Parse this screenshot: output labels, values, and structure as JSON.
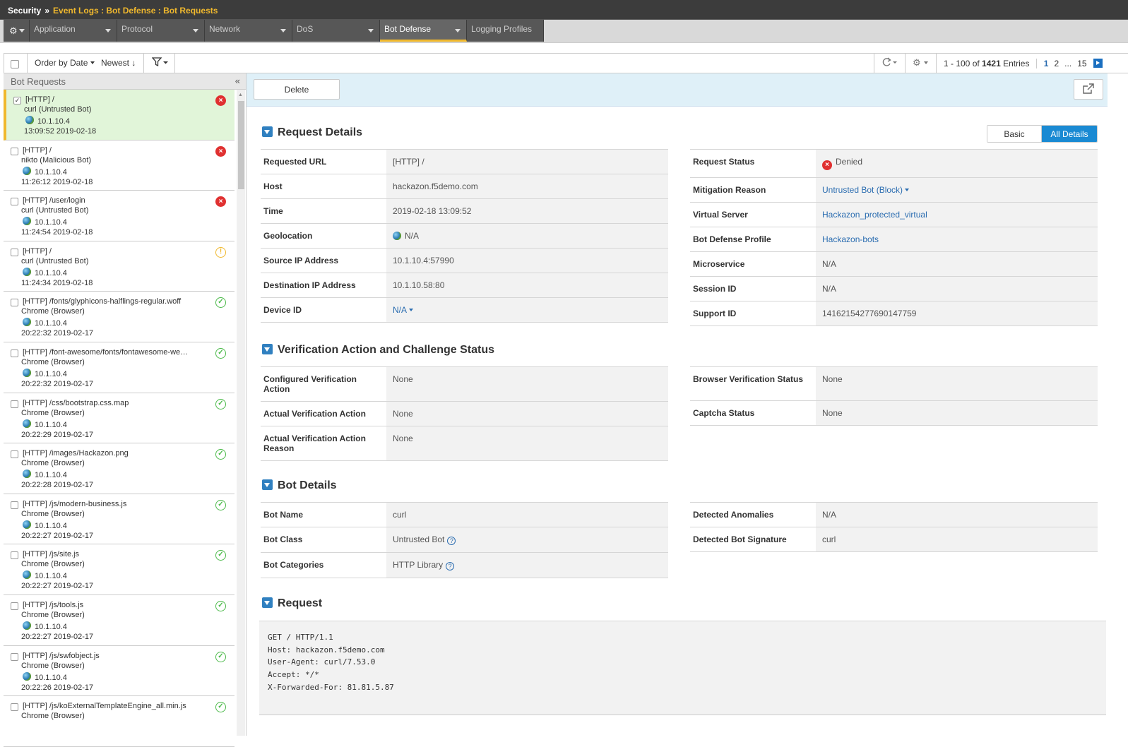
{
  "breadcrumb": {
    "root": "Security",
    "separator": "»",
    "path": "Event Logs : Bot Defense : Bot Requests"
  },
  "tabs": [
    {
      "label": "Application",
      "active": false
    },
    {
      "label": "Protocol",
      "active": false
    },
    {
      "label": "Network",
      "active": false
    },
    {
      "label": "DoS",
      "active": false
    },
    {
      "label": "Bot Defense",
      "active": true
    },
    {
      "label": "Logging Profiles",
      "active": false
    }
  ],
  "toolbar": {
    "order_by": "Order by Date",
    "order_dir": "Newest ↓",
    "range": "1 - 100 of",
    "total": "1421",
    "entries": "Entries",
    "pages": [
      "1",
      "2",
      "...",
      "15"
    ]
  },
  "list": {
    "title": "Bot Requests",
    "collapse": "«",
    "items": [
      {
        "url": "[HTTP] /",
        "client": "curl (Untrusted Bot)",
        "ip": "10.1.10.4",
        "time": "13:09:52 2019-02-18",
        "status": "denied",
        "selected": true
      },
      {
        "url": "[HTTP] /",
        "client": "nikto (Malicious Bot)",
        "ip": "10.1.10.4",
        "time": "11:26:12 2019-02-18",
        "status": "denied",
        "selected": false
      },
      {
        "url": "[HTTP] /user/login",
        "client": "curl (Untrusted Bot)",
        "ip": "10.1.10.4",
        "time": "11:24:54 2019-02-18",
        "status": "denied",
        "selected": false
      },
      {
        "url": "[HTTP] /",
        "client": "curl (Untrusted Bot)",
        "ip": "10.1.10.4",
        "time": "11:24:34 2019-02-18",
        "status": "warning",
        "selected": false
      },
      {
        "url": "[HTTP] /fonts/glyphicons-halflings-regular.woff",
        "client": "Chrome (Browser)",
        "ip": "10.1.10.4",
        "time": "20:22:32 2019-02-17",
        "status": "ok",
        "selected": false
      },
      {
        "url": "[HTTP] /font-awesome/fonts/fontawesome-webf…",
        "client": "Chrome (Browser)",
        "ip": "10.1.10.4",
        "time": "20:22:32 2019-02-17",
        "status": "ok",
        "selected": false
      },
      {
        "url": "[HTTP] /css/bootstrap.css.map",
        "client": "Chrome (Browser)",
        "ip": "10.1.10.4",
        "time": "20:22:29 2019-02-17",
        "status": "ok",
        "selected": false
      },
      {
        "url": "[HTTP] /images/Hackazon.png",
        "client": "Chrome (Browser)",
        "ip": "10.1.10.4",
        "time": "20:22:28 2019-02-17",
        "status": "ok",
        "selected": false
      },
      {
        "url": "[HTTP] /js/modern-business.js",
        "client": "Chrome (Browser)",
        "ip": "10.1.10.4",
        "time": "20:22:27 2019-02-17",
        "status": "ok",
        "selected": false
      },
      {
        "url": "[HTTP] /js/site.js",
        "client": "Chrome (Browser)",
        "ip": "10.1.10.4",
        "time": "20:22:27 2019-02-17",
        "status": "ok",
        "selected": false
      },
      {
        "url": "[HTTP] /js/tools.js",
        "client": "Chrome (Browser)",
        "ip": "10.1.10.4",
        "time": "20:22:27 2019-02-17",
        "status": "ok",
        "selected": false
      },
      {
        "url": "[HTTP] /js/swfobject.js",
        "client": "Chrome (Browser)",
        "ip": "10.1.10.4",
        "time": "20:22:26 2019-02-17",
        "status": "ok",
        "selected": false
      },
      {
        "url": "[HTTP] /js/koExternalTemplateEngine_all.min.js",
        "client": "Chrome (Browser)",
        "ip": "",
        "time": "",
        "status": "ok",
        "selected": false
      }
    ]
  },
  "detail": {
    "delete_label": "Delete",
    "view_basic": "Basic",
    "view_all": "All Details",
    "sections": {
      "request_details": "Request Details",
      "verification": "Verification Action and Challenge Status",
      "bot_details": "Bot Details",
      "request": "Request"
    },
    "request_left": [
      {
        "k": "Requested URL",
        "v": "[HTTP] /"
      },
      {
        "k": "Host",
        "v": "hackazon.f5demo.com"
      },
      {
        "k": "Time",
        "v": "2019-02-18 13:09:52"
      },
      {
        "k": "Geolocation",
        "v": "N/A"
      },
      {
        "k": "Source IP Address",
        "v": "10.1.10.4:57990"
      },
      {
        "k": "Destination IP Address",
        "v": "10.1.10.58:80"
      },
      {
        "k": "Device ID",
        "v": "N/A"
      }
    ],
    "request_right": [
      {
        "k": "Request Status",
        "v": "Denied"
      },
      {
        "k": "Mitigation Reason",
        "v": "Untrusted Bot (Block)"
      },
      {
        "k": "Virtual Server",
        "v": "Hackazon_protected_virtual"
      },
      {
        "k": "Bot Defense Profile",
        "v": "Hackazon-bots"
      },
      {
        "k": "Microservice",
        "v": "N/A"
      },
      {
        "k": "Session ID",
        "v": "N/A"
      },
      {
        "k": "Support ID",
        "v": "14162154277690147759"
      }
    ],
    "verif_left": [
      {
        "k": "Configured Verification Action",
        "v": "None"
      },
      {
        "k": "Actual Verification Action",
        "v": "None"
      },
      {
        "k": "Actual Verification Action Reason",
        "v": "None"
      }
    ],
    "verif_right": [
      {
        "k": "Browser Verification Status",
        "v": "None"
      },
      {
        "k": "Captcha Status",
        "v": "None"
      }
    ],
    "bot_left": [
      {
        "k": "Bot Name",
        "v": "curl"
      },
      {
        "k": "Bot Class",
        "v": "Untrusted Bot"
      },
      {
        "k": "Bot Categories",
        "v": "HTTP Library"
      }
    ],
    "bot_right": [
      {
        "k": "Detected Anomalies",
        "v": "N/A"
      },
      {
        "k": "Detected Bot Signature",
        "v": "curl"
      }
    ],
    "raw_request": "GET / HTTP/1.1\nHost: hackazon.f5demo.com\nUser-Agent: curl/7.53.0\nAccept: */*\nX-Forwarded-For: 81.81.5.87"
  },
  "colors": {
    "accent": "#f0b82d",
    "link": "#2a6cb0",
    "active_segment": "#1a8ad3",
    "denied": "#e03131",
    "ok": "#4cba4a"
  }
}
